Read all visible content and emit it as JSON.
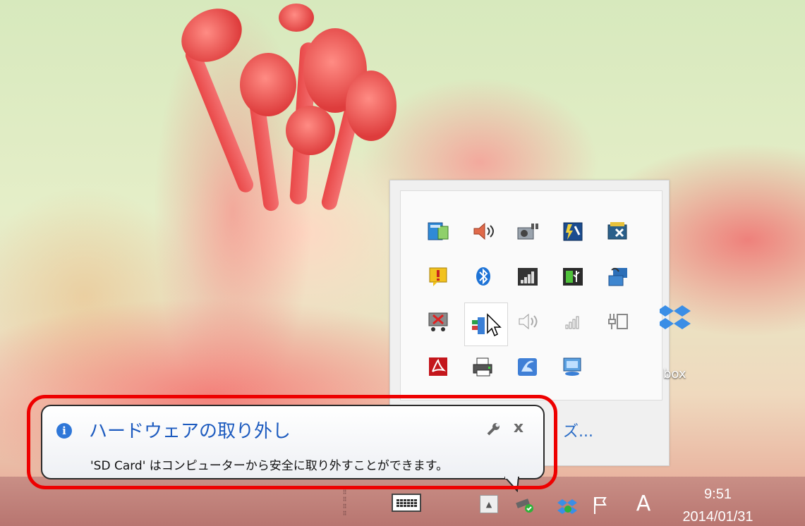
{
  "notification": {
    "title": "ハードウェアの取り外し",
    "message": "'SD Card' はコンピューターから安全に取り外すことができます。",
    "close_label": "x",
    "info_glyph": "i"
  },
  "overflow_panel": {
    "customize_link": "カスタマイズ...",
    "customize_visible": "ズ..."
  },
  "desktop": {
    "dropbox_label": "box"
  },
  "taskbar": {
    "show_hidden_glyph": "▲",
    "ime_mode": "A",
    "clock_time": "9:51",
    "clock_date": "2014/01/31"
  },
  "colors": {
    "highlight_border": "#ee0000",
    "notification_title": "#1d5bbf",
    "info_icon": "#2f77d8",
    "link": "#2a6cc6"
  },
  "tray_icons": [
    "network-monitor-icon",
    "volume-icon",
    "power-plug-icon",
    "battery-wrench-icon",
    "network-disconnected-icon",
    "notification-flag-icon",
    "bluetooth-icon",
    "signal-strength-icon",
    "usb-battery-icon",
    "network-sync-icon",
    "display-disabled-icon",
    "safely-remove-hardware-icon",
    "volume-muted-icon",
    "wifi-signal-icon",
    "power-outlet-icon",
    "acrobat-icon",
    "printer-icon",
    "app-shield-icon",
    "display-settings-icon"
  ]
}
